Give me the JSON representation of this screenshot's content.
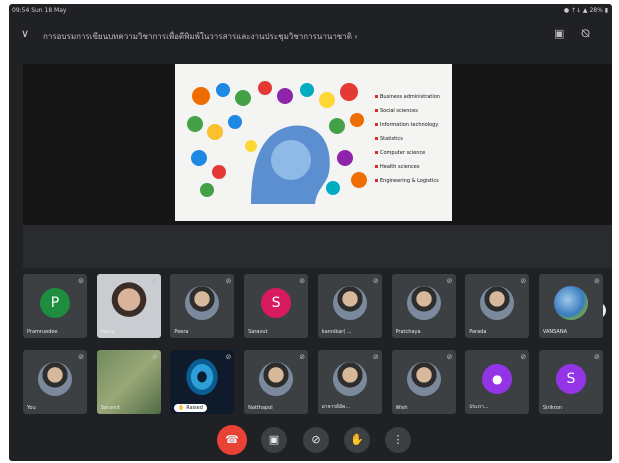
{
  "status_bar": {
    "time": "09:54  Sun 18 May",
    "indicators": "● ↑↓ ▲ 28% ▮"
  },
  "title_bar": {
    "back_icon": "chevron-down-icon",
    "title": "การอบรมการเขียนบทความวิชาการเพื่อตีพิมพ์ในวารสารและงานประชุมวิชาการนานาชาติ ›",
    "icons": [
      "rotate-camera-icon",
      "speaker-off-icon"
    ]
  },
  "presentation": {
    "slide_items": [
      "Business administration",
      "Social sciences",
      "Information technology",
      "Statistics",
      "Computer science",
      "Health sciences",
      "Engineering & Logistics"
    ],
    "fullscreen_icon": "fullscreen-icon"
  },
  "participants": [
    {
      "name": "Pramruedee",
      "initial": "P",
      "color": "#1e8e3e",
      "kind": "initial"
    },
    {
      "name": "Peera",
      "kind": "video-face"
    },
    {
      "name": "Peera",
      "kind": "photo"
    },
    {
      "name": "Saravut",
      "initial": "S",
      "color": "#d81b60",
      "kind": "initial"
    },
    {
      "name": "kannikar( ...",
      "kind": "photo"
    },
    {
      "name": "Pratchaya",
      "kind": "photo"
    },
    {
      "name": "Parada",
      "kind": "photo"
    },
    {
      "name": "VANSANA",
      "kind": "photo-earth"
    },
    {
      "name": "You",
      "kind": "photo"
    },
    {
      "name": "Saravut",
      "kind": "video-green"
    },
    {
      "name": "",
      "kind": "video-eye",
      "badge": "✋ Raised"
    },
    {
      "name": "Natthapol",
      "kind": "photo"
    },
    {
      "name": "อาจารย์อัค...",
      "kind": "photo"
    },
    {
      "name": "Wish",
      "kind": "photo"
    },
    {
      "name": "ประภา...",
      "kind": "person-icon",
      "color": "#9334e6"
    },
    {
      "name": "Sirikron",
      "initial": "S",
      "color": "#9334e6",
      "kind": "initial"
    }
  ],
  "controls": [
    {
      "name": "end-call-button",
      "icon": "☎"
    },
    {
      "name": "camera-toggle-button",
      "icon": "▣"
    },
    {
      "name": "mic-toggle-button",
      "icon": "⊘"
    },
    {
      "name": "raise-hand-button",
      "icon": "✋"
    },
    {
      "name": "more-options-button",
      "icon": "⋮"
    }
  ]
}
